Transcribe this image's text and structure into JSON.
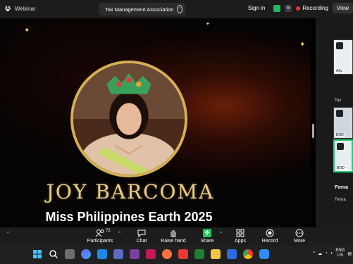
{
  "window": {
    "app_label": "Webinar",
    "meeting_title": "Tax Management Association",
    "sign_in": "Sign in",
    "recording": "Recording",
    "view": "View"
  },
  "stage": {
    "headline": "JOY BARCOMA",
    "subtitle": "Miss Philippines Earth 2025"
  },
  "right_panel": {
    "tiles": [
      "Atty.",
      "Tax",
      "BOD",
      "BOD -"
    ],
    "name_heading": "Ferna",
    "name_sub": "Ferna"
  },
  "toolbar": {
    "participants_label": "Participants",
    "participants_count": "72",
    "chat_label": "Chat",
    "raise_hand_label": "Raise hand",
    "share_label": "Share",
    "apps_label": "Apps",
    "record_label": "Record",
    "more_label": "More"
  },
  "taskbar": {
    "lang_line1": "ENG",
    "lang_line2": "US"
  },
  "colors": {
    "accent_gold": "#d4af55",
    "recording_red": "#e53935",
    "share_green": "#22c55e"
  }
}
